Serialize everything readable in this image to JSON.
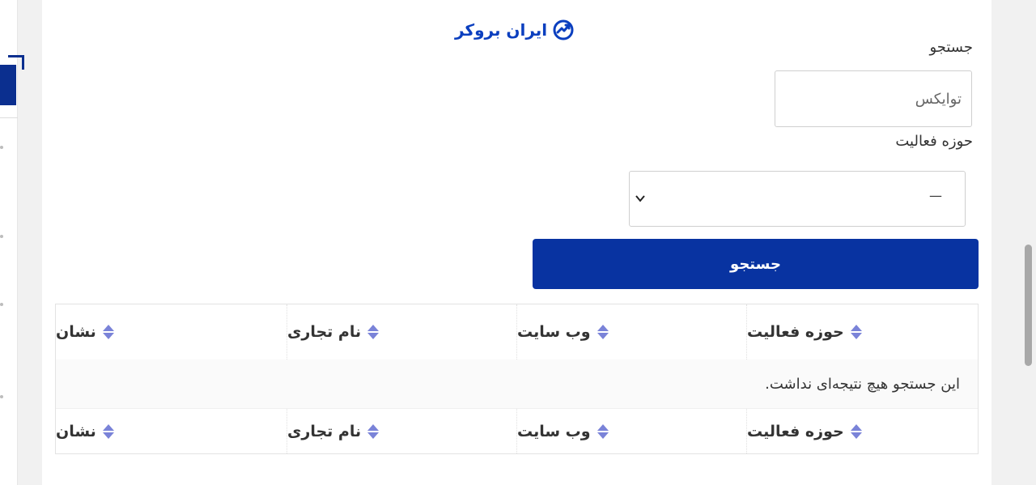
{
  "logo": {
    "text": "ایران بروکر",
    "icon": "chart-trend-icon",
    "color": "#0b3fbf"
  },
  "search": {
    "label": "جستجو",
    "input_value": "توایکس"
  },
  "activity": {
    "label": "حوزه فعالیت",
    "selected": "—"
  },
  "search_button": {
    "label": "جستجو",
    "color": "#0833a1"
  },
  "table": {
    "columns": [
      {
        "label": "حوزه فعالیت"
      },
      {
        "label": "وب سایت"
      },
      {
        "label": "نام تجاری"
      },
      {
        "label": "نشان"
      }
    ],
    "empty_message": "این جستجو هیچ نتیجه‌ای نداشت."
  },
  "colors": {
    "sort_icon": "#7a83d8",
    "accent": "#0b2f8f"
  }
}
